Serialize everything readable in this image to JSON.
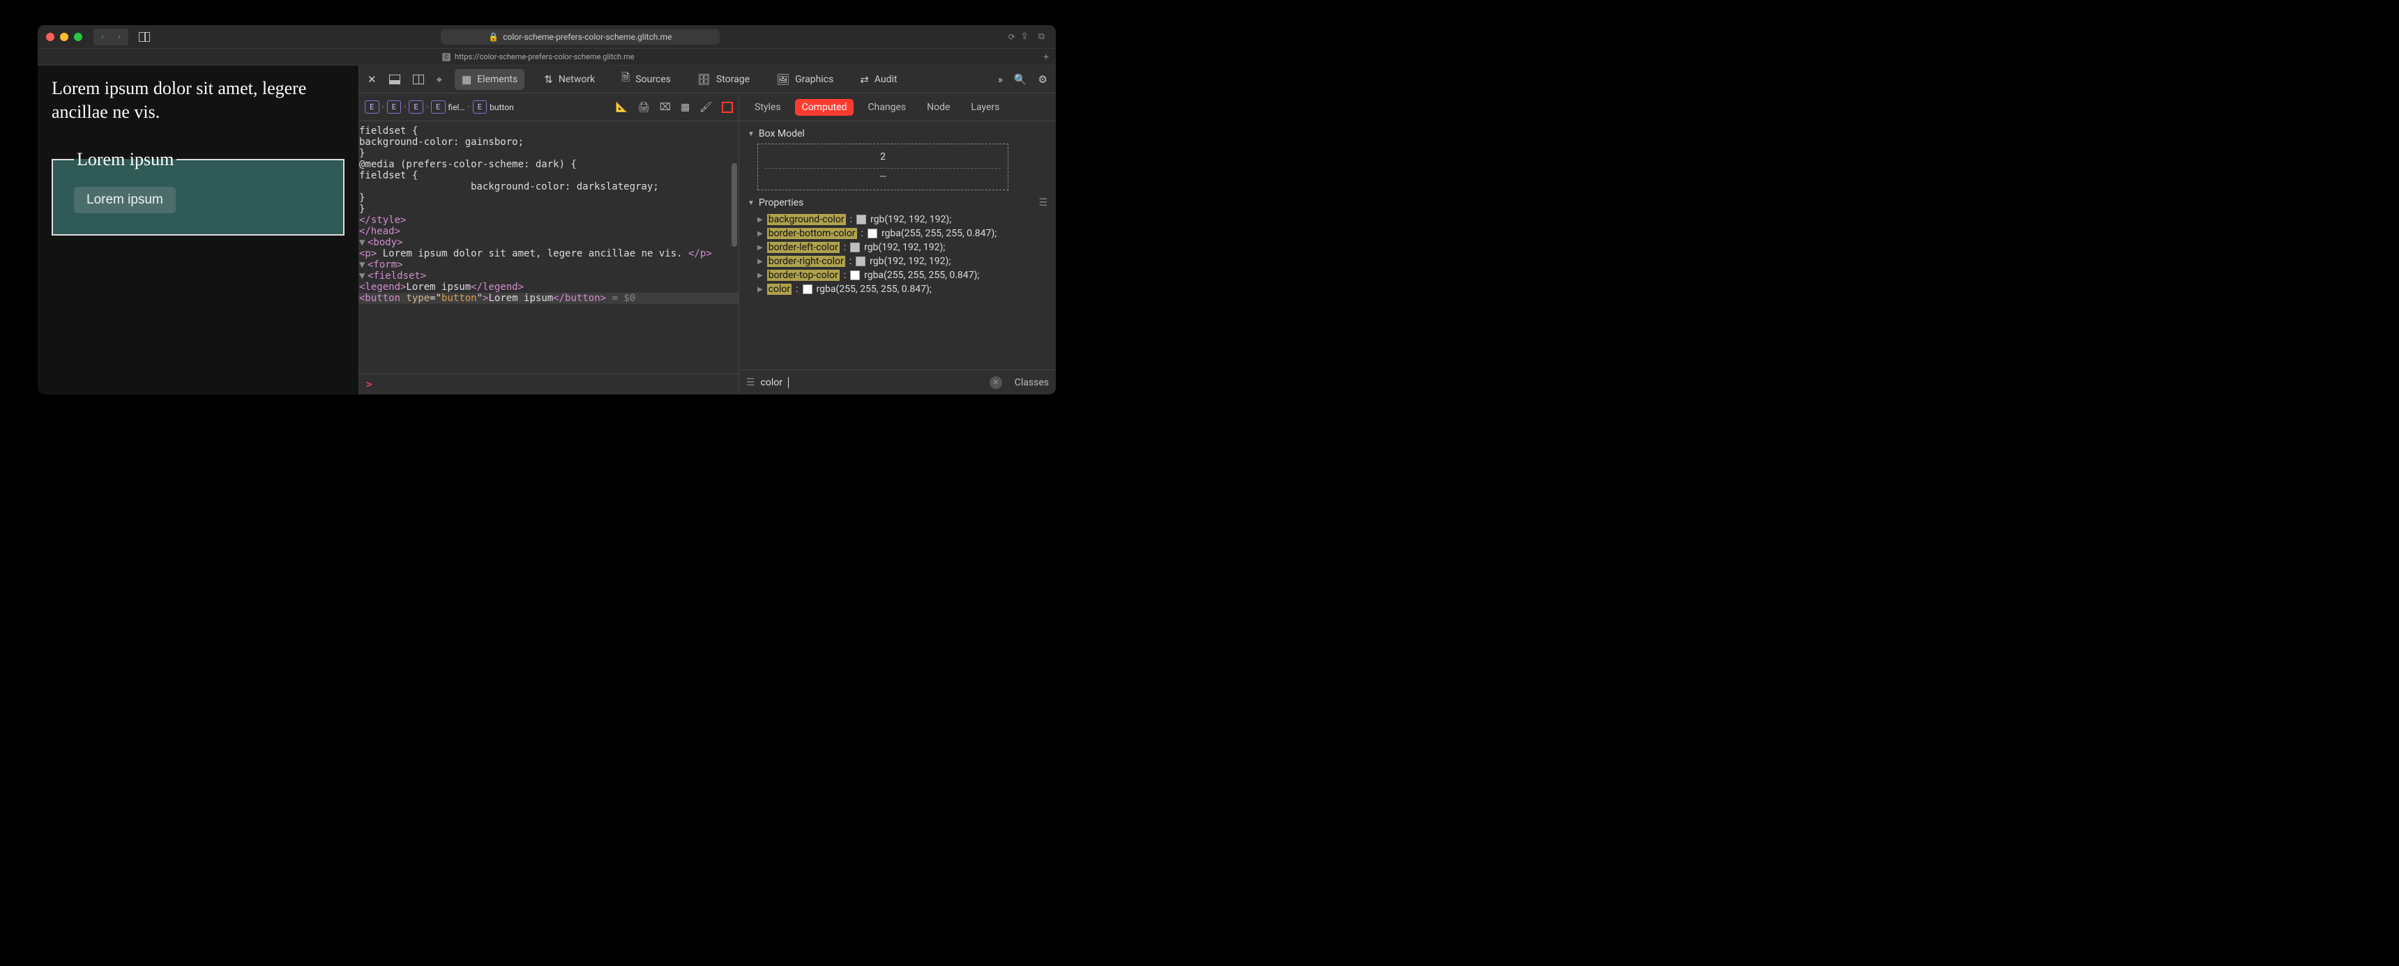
{
  "titlebar": {
    "url_display": "color-scheme-prefers-color-scheme.glitch.me",
    "lock_icon": "🔒"
  },
  "tabstrip": {
    "favicon_label": "C",
    "url": "https://color-scheme-prefers-color-scheme.glitch.me"
  },
  "page": {
    "paragraph": "Lorem ipsum dolor sit amet, legere ancillae ne vis.",
    "legend": "Lorem ipsum",
    "button_label": "Lorem ipsum"
  },
  "devtools": {
    "tabs": [
      "Elements",
      "Network",
      "Sources",
      "Storage",
      "Graphics",
      "Audit"
    ],
    "breadcrumb": [
      {
        "chip": "E",
        "label": ""
      },
      {
        "chip": "E",
        "label": ""
      },
      {
        "chip": "E",
        "label": ""
      },
      {
        "chip": "E",
        "label": "fiel…"
      },
      {
        "chip": "E",
        "label": "button"
      }
    ],
    "right_tabs": [
      "Styles",
      "Computed",
      "Changes",
      "Node",
      "Layers"
    ],
    "right_active_tab": "Computed",
    "box_model": {
      "heading": "Box Model",
      "top_value": "2",
      "bottom_value": "—"
    },
    "properties_heading": "Properties",
    "properties": [
      {
        "name": "background-color",
        "value": "rgb(192, 192, 192)",
        "swatch": "silver"
      },
      {
        "name": "border-bottom-color",
        "value": "rgba(255, 255, 255, 0.847)",
        "swatch": "white"
      },
      {
        "name": "border-left-color",
        "value": "rgb(192, 192, 192)",
        "swatch": "silver"
      },
      {
        "name": "border-right-color",
        "value": "rgb(192, 192, 192)",
        "swatch": "silver"
      },
      {
        "name": "border-top-color",
        "value": "rgba(255, 255, 255, 0.847)",
        "swatch": "white"
      },
      {
        "name": "color",
        "value": "rgba(255, 255, 255, 0.847)",
        "swatch": "white"
      }
    ],
    "filter_text": "color",
    "classes_label": "Classes",
    "console_prompt": ">"
  },
  "dom_lines": [
    "fieldset {",
    "  background-color: gainsboro;",
    "}",
    "@media (prefers-color-scheme: dark) {",
    "  fieldset {",
    "    background-color: darkslategray;",
    "  }",
    "}",
    "</style>",
    "</head>",
    "<body>",
    "<p> Lorem ipsum dolor sit amet, legere ancillae ne vis. </p>",
    "<form>",
    "<fieldset>",
    "<legend>Lorem ipsum</legend>",
    "<button type=\"button\">Lorem ipsum</button> = $0"
  ]
}
